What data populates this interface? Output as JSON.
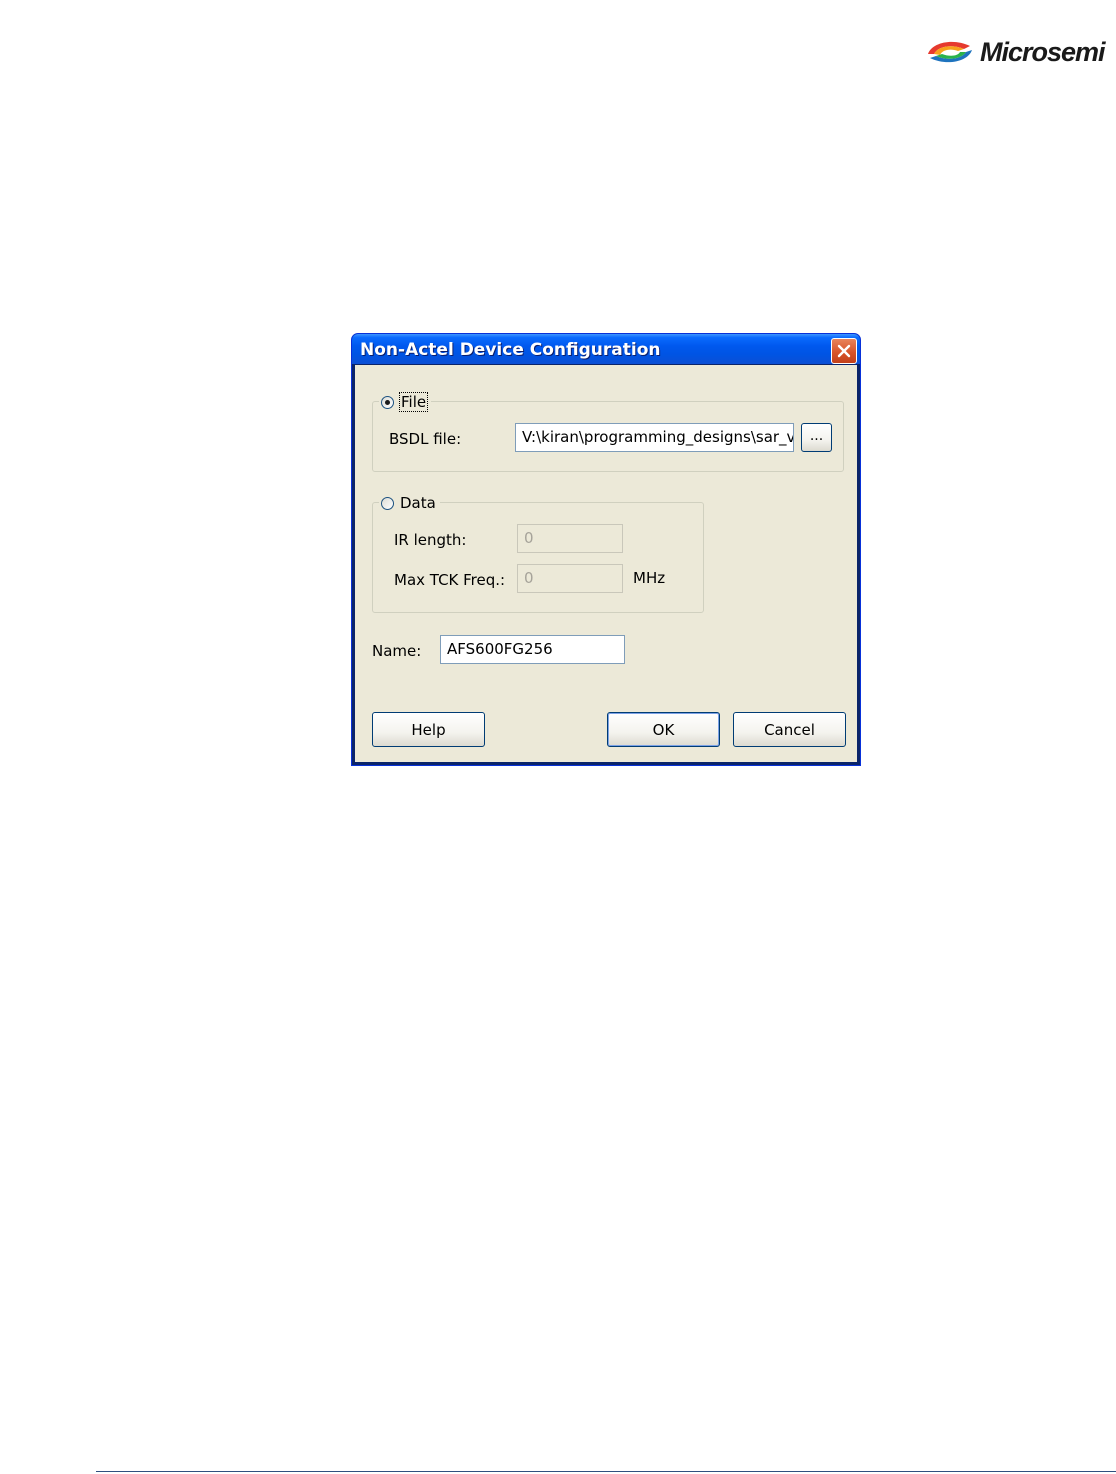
{
  "logo": {
    "text": "Microsemi"
  },
  "dialog": {
    "title": "Non-Actel Device Configuration",
    "file_group": {
      "radio_label": "File",
      "selected": true,
      "bsdl_label": "BSDL file:",
      "bsdl_value": "V:\\kiran\\programming_designs\\sar_v",
      "browse_label": "..."
    },
    "data_group": {
      "radio_label": "Data",
      "selected": false,
      "ir_length_label": "IR length:",
      "ir_length_value": "0",
      "max_tck_label": "Max TCK Freq.:",
      "max_tck_value": "0",
      "max_tck_unit": "MHz"
    },
    "name_label": "Name:",
    "name_value": "AFS600FG256",
    "buttons": {
      "help": "Help",
      "ok": "OK",
      "cancel": "Cancel"
    }
  },
  "colors": {
    "titlebar": "#0054e3",
    "dialog_face": "#ece9d8",
    "footer_rule": "#2f4f7f"
  }
}
